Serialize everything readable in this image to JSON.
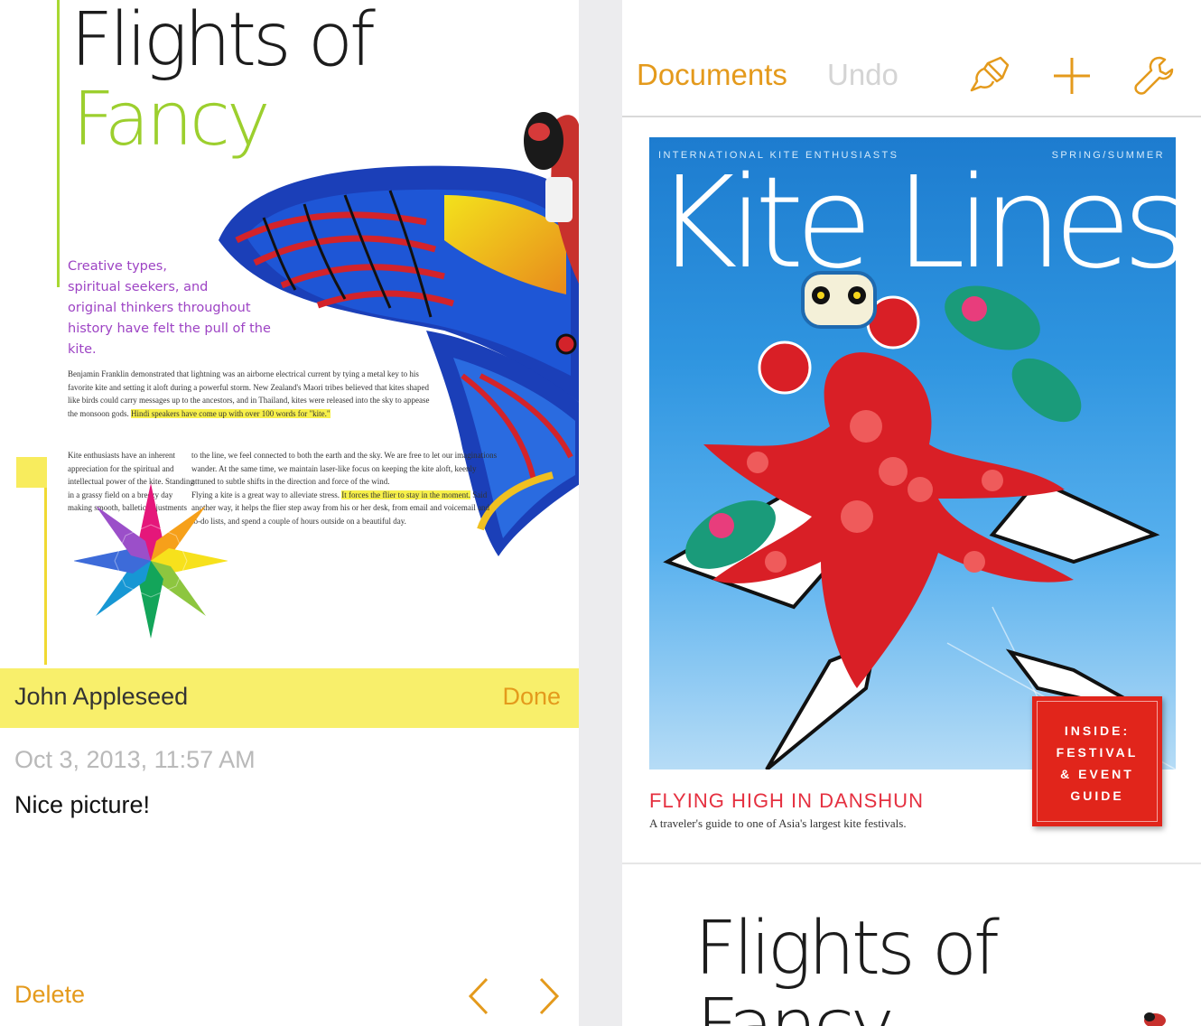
{
  "left_screen": {
    "document": {
      "title_line1": "Flights of",
      "title_line2": "Fancy",
      "pull_quote": [
        "Creative types,",
        "spiritual seekers, and",
        "original thinkers throughout",
        "history have felt the pull of the kite."
      ],
      "body_para1": "Benjamin Franklin demonstrated that lightning was an airborne electrical current by tying a metal key to his favorite kite and setting it aloft during a powerful storm. New Zealand's Maori tribes believed that kites shaped like birds could carry messages up to the ancestors, and in Thailand, kites were released into the sky to appease the monsoon gods.",
      "body_para1_highlight": "Hindi speakers have come up with over 100 words for \"kite.\"",
      "body_para2_left": "Kite enthusiasts have an inherent appreciation for the spiritual and intellectual power of the kite. Standing in a grassy field on a breezy day making smooth, balletic adjustments",
      "body_para2_right": "to the line, we feel connected to both the earth and the sky. We are free to let our imaginations wander. At the same time, we maintain laser-like focus on keeping the kite aloft, keenly attuned to subtle shifts in the direction and force of the wind.",
      "body_para3_pre": "Flying a kite is a great way to alleviate stress.",
      "body_para3_highlight": "It forces the flier to stay in the moment.",
      "body_para3_post": "Said another way, it helps the flier step away from his or her desk, from email and voicemail and to-do lists, and spend a couple of hours outside on a beautiful day."
    },
    "comment": {
      "author": "John Appleseed",
      "done_label": "Done",
      "date": "Oct 3, 2013, 11:57 AM",
      "text": "Nice picture!",
      "delete_label": "Delete"
    },
    "colors": {
      "accent": "#e49a1c",
      "comment_yellow": "#f8ef6b",
      "title_green": "#9ccf2e",
      "pull_purple": "#9d43c4"
    }
  },
  "right_screen": {
    "toolbar": {
      "documents_label": "Documents",
      "undo_label": "Undo",
      "icons": [
        "paintbrush-icon",
        "plus-icon",
        "wrench-icon"
      ]
    },
    "cover": {
      "header_left": "INTERNATIONAL KITE ENTHUSIASTS",
      "header_right": "SPRING/SUMMER",
      "title": "Kite Lines",
      "badge_lines": [
        "INSIDE:",
        "FESTIVAL",
        "& EVENT",
        "GUIDE"
      ],
      "story_title": "FLYING HIGH IN DANSHUN",
      "story_subtitle": "A traveler's guide to one of Asia's largest kite festivals."
    },
    "next_document": {
      "title_line1": "Flights of",
      "title_line2": "Fancy"
    }
  }
}
